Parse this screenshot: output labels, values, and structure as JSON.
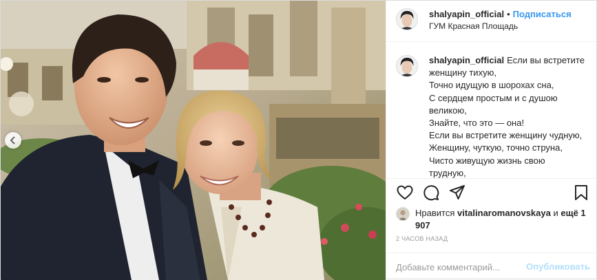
{
  "header": {
    "username": "shalyapin_official",
    "separator": "•",
    "follow_label": "Подписаться",
    "location": "ГУМ Красная Площадь"
  },
  "caption": {
    "username": "shalyapin_official",
    "lines": [
      "Если вы встретите",
      "женщину тихую,",
      "Точно идущую в шорохах сна,",
      "С сердцем простым и с душою",
      "великою,",
      "Знайте, что это — она!",
      "Если вы встретите женщину чудную,",
      "Женщину, чуткую, точно струна,",
      "Чисто живущую жизнь свою",
      "трудную,"
    ]
  },
  "actions": {
    "like_icon": "heart-icon",
    "comment_icon": "comment-bubble-icon",
    "share_icon": "share-paper-plane-icon",
    "save_icon": "bookmark-icon"
  },
  "likes": {
    "prefix": "Нравится",
    "user": "vitalinaromanovskaya",
    "conjunction": "и",
    "more": "ещё 1 907"
  },
  "time": "2 часов назад",
  "comment": {
    "placeholder": "Добавьте комментарий...",
    "publish_label": "Опубликовать"
  },
  "colors": {
    "link": "#3897f0",
    "publish_disabled": "#b2dffc",
    "muted": "#999999",
    "border": "#efefef"
  }
}
